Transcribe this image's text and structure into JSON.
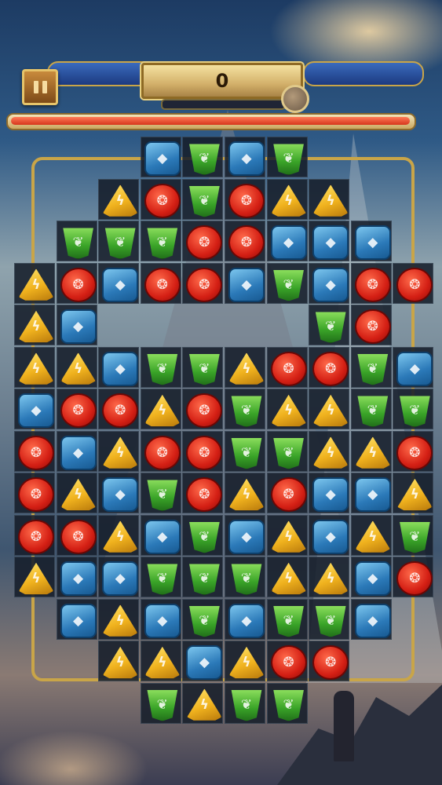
{
  "hud": {
    "score": "0",
    "pause_icon": "pause-icon",
    "medal_icon": "medal-icon",
    "level_progress": 1.0
  },
  "colors": {
    "red": "#d41f14",
    "blue": "#2b79b8",
    "green": "#3aa428",
    "yellow": "#f0b21e"
  },
  "gem_icons": {
    "red": "fire-icon",
    "blue": "water-drop-icon",
    "green": "leaf-icon",
    "yellow": "lightning-icon"
  },
  "board": {
    "rows": [
      "...BGBG...",
      "..YRGRYY..",
      ".GGGRRBBB.",
      "YRBRRBGBRR",
      "YB.....GR.",
      "YYBGGYRRGB",
      "BRRYRGYYGG",
      "RBYRRGGYYR",
      "RYBGRYRBBY",
      "RRYBGBYBYG",
      "YBBGGGYYBR",
      ".BYBGBGGB.",
      "..YYBYRR..",
      "...GYGG..."
    ],
    "legend": {
      "R": "red",
      "B": "blue",
      "G": "green",
      "Y": "yellow"
    }
  }
}
